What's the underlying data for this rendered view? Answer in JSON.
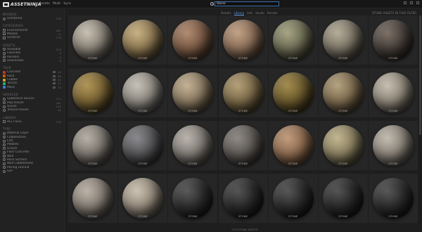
{
  "app": {
    "logo_text": "ASSETNINJA",
    "nav": [
      "Assets",
      "Multi",
      "Sync"
    ]
  },
  "search": {
    "value": "Stone"
  },
  "sidebar": {
    "sections": [
      {
        "title": "Browse",
        "items": [
          {
            "label": "Unfiltered",
            "count": "576",
            "icon": "grid-icon"
          }
        ]
      },
      {
        "title": "Categories",
        "items": [
          {
            "label": "Environments",
            "count": "401",
            "icon": "folder-icon"
          },
          {
            "label": "Models",
            "count": "12",
            "icon": "folder-icon"
          },
          {
            "label": "Surfaces",
            "count": "576",
            "icon": "folder-icon"
          }
        ]
      },
      {
        "title": "Assets",
        "items": [
          {
            "label": "Available",
            "count": "576",
            "icon": "check-icon"
          },
          {
            "label": "Favorites",
            "count": "0",
            "icon": "star-icon"
          },
          {
            "label": "Renders",
            "count": "0",
            "icon": "image-icon"
          },
          {
            "label": "Downloads",
            "count": "0",
            "icon": "download-icon"
          }
        ]
      },
      {
        "title": "Tags",
        "items": [
          {
            "label": "Concrete",
            "count": "48",
            "color": "#c0392b"
          },
          {
            "label": "Rock",
            "count": "96",
            "color": "#d35400"
          },
          {
            "label": "Cobble",
            "count": "40",
            "color": "#c9a227"
          },
          {
            "label": "Terrain",
            "count": "22",
            "color": "#27ae60"
          },
          {
            "label": "Moss",
            "count": "18",
            "color": "#3b7dd8"
          }
        ]
      },
      {
        "title": "Sources",
        "items": [
          {
            "label": "Substance Source",
            "count": "214",
            "icon": "source-icon"
          },
          {
            "label": "Poly Haven",
            "count": "161",
            "icon": "source-icon"
          },
          {
            "label": "Quixel",
            "count": "143",
            "icon": "source-icon"
          },
          {
            "label": "Texture Haven",
            "count": "58",
            "icon": "source-icon"
          }
        ]
      },
      {
        "title": "Library",
        "items": [
          {
            "label": "ALL FILES",
            "count": "576",
            "icon": "library-icon"
          }
        ]
      },
      {
        "title": "Type",
        "items": [
          {
            "label": "Material Layer",
            "count": "",
            "icon": "type-icon"
          },
          {
            "label": "Cobblestone",
            "count": "",
            "icon": "type-icon"
          },
          {
            "label": "Cliff",
            "count": "",
            "icon": "type-icon"
          },
          {
            "label": "Pebbles",
            "count": "",
            "icon": "type-icon"
          },
          {
            "label": "Gravel",
            "count": "",
            "icon": "type-icon"
          },
          {
            "label": "Floor Concrete",
            "count": "",
            "icon": "type-icon"
          },
          {
            "label": "Wall",
            "count": "",
            "icon": "type-icon"
          },
          {
            "label": "Rock Surface",
            "count": "",
            "icon": "type-icon"
          },
          {
            "label": "Wall Cobblestone",
            "count": "",
            "icon": "type-icon"
          },
          {
            "label": "Paving Ground",
            "count": "",
            "icon": "type-icon"
          },
          {
            "label": "Soil",
            "count": "",
            "icon": "type-icon"
          }
        ]
      }
    ]
  },
  "view": {
    "tabs": [
      "Details",
      "Library",
      "Info",
      "Vaults",
      "Render"
    ],
    "active": 1,
    "sort_label": "STONE ASSETS IN THIS FILTER"
  },
  "tiles": [
    {
      "caption": "STONE",
      "base": "#8a8378",
      "dark": "#3d3934",
      "light": "#c9c1b3"
    },
    {
      "caption": "STONE",
      "base": "#8d7852",
      "dark": "#3a3020",
      "light": "#c8b285"
    },
    {
      "caption": "STONE",
      "base": "#7b5b46",
      "dark": "#33241a",
      "light": "#b08c72"
    },
    {
      "caption": "STONE",
      "base": "#8b6e58",
      "dark": "#3c2d22",
      "light": "#c2a387"
    },
    {
      "caption": "STONE",
      "base": "#6e6d55",
      "dark": "#2d2c20",
      "light": "#a8a585"
    },
    {
      "caption": "STONE",
      "base": "#7c7567",
      "dark": "#353128",
      "light": "#b7ad99"
    },
    {
      "caption": "STONE",
      "base": "#48403b",
      "dark": "#1c1714",
      "light": "#7d7167"
    },
    {
      "caption": "STONE",
      "base": "#7b6535",
      "dark": "#2f2612",
      "light": "#b09558"
    },
    {
      "caption": "STONE",
      "base": "#8e8a82",
      "dark": "#3b3935",
      "light": "#c6c1b8"
    },
    {
      "caption": "STONE",
      "base": "#8a7a62",
      "dark": "#382f22",
      "light": "#c4b295"
    },
    {
      "caption": "STONE",
      "base": "#7c6b4a",
      "dark": "#33291a",
      "light": "#b5a077"
    },
    {
      "caption": "STONE",
      "base": "#6c5b2e",
      "dark": "#2a220e",
      "light": "#a38b4d"
    },
    {
      "caption": "STONE",
      "base": "#7d6c50",
      "dark": "#33291d",
      "light": "#b5a280"
    },
    {
      "caption": "STONE",
      "base": "#8f877a",
      "dark": "#3b3730",
      "light": "#c7bfb0"
    },
    {
      "caption": "STONE",
      "base": "#7d7770",
      "dark": "#35322e",
      "light": "#b7b0a7"
    },
    {
      "caption": "STONE",
      "base": "#565658",
      "dark": "#1f1f21",
      "light": "#8a8a8e"
    },
    {
      "caption": "STONE",
      "base": "#817c76",
      "dark": "#35322e",
      "light": "#bab4ad"
    },
    {
      "caption": "STONE",
      "base": "#5d5954",
      "dark": "#23211e",
      "light": "#8f8a84"
    },
    {
      "caption": "STONE",
      "base": "#8c6a4f",
      "dark": "#3a2a1e",
      "light": "#c29d7e"
    },
    {
      "caption": "STONE",
      "base": "#8a8060",
      "dark": "#363122",
      "light": "#c2b690"
    },
    {
      "caption": "STONE",
      "base": "#8b847a",
      "dark": "#3a3631",
      "light": "#c4bcb0"
    },
    {
      "caption": "STONE",
      "base": "#867e75",
      "dark": "#37332e",
      "light": "#bcb3a8"
    },
    {
      "caption": "STONE",
      "base": "#948a7c",
      "dark": "#3c3731",
      "light": "#cdc2b2"
    },
    {
      "caption": "STONE",
      "base": "#2e2e2e",
      "dark": "#0f0f0f",
      "light": "#5a5a5a"
    },
    {
      "caption": "STONE",
      "base": "#2b2b2b",
      "dark": "#0e0e0e",
      "light": "#555555"
    },
    {
      "caption": "STONE",
      "base": "#2c2c2c",
      "dark": "#0e0e0e",
      "light": "#575757"
    },
    {
      "caption": "STONE",
      "base": "#2a2a2a",
      "dark": "#0d0d0d",
      "light": "#545454"
    },
    {
      "caption": "STONE",
      "base": "#2d2d2d",
      "dark": "#0e0e0e",
      "light": "#585858"
    }
  ],
  "footer": {
    "text": "576 STONE ASSETS"
  }
}
